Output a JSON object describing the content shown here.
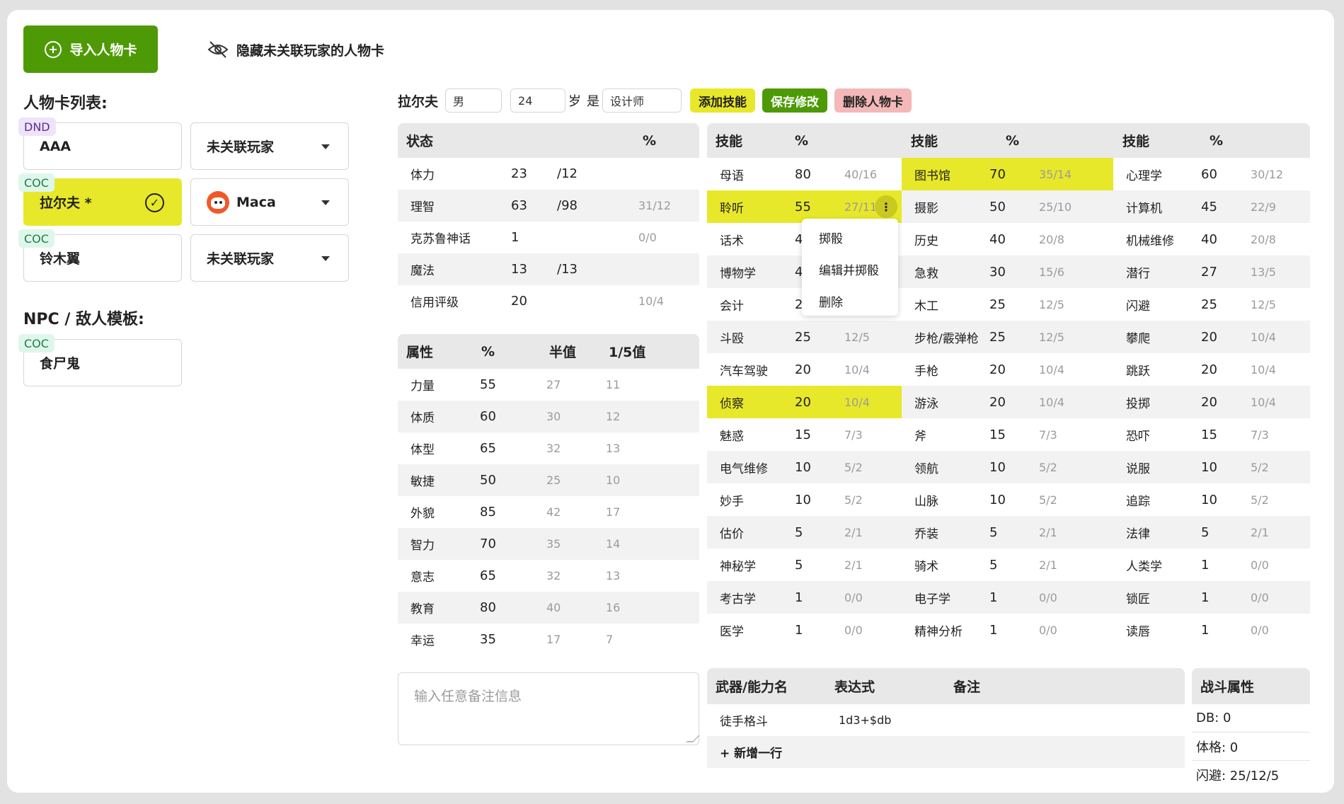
{
  "toolbar": {
    "import_label": "导入人物卡",
    "hide_label": "隐藏未关联玩家的人物卡"
  },
  "character_list": {
    "title": "人物卡列表:",
    "items": [
      {
        "tag": "DND",
        "name": "AAA",
        "player": "未关联玩家"
      },
      {
        "tag": "COC",
        "name": "拉尔夫 *",
        "player": "Maca"
      },
      {
        "tag": "COC",
        "name": "铃木翼",
        "player": "未关联玩家"
      }
    ]
  },
  "npc_list": {
    "title": "NPC / 敌人模板:",
    "items": [
      {
        "tag": "COC",
        "name": "食尸鬼"
      }
    ]
  },
  "header": {
    "name": "拉尔夫",
    "gender": "男",
    "age": "24",
    "age_suffix": "岁",
    "is_label": "是",
    "occupation": "设计师",
    "add_skill": "添加技能",
    "save": "保存修改",
    "delete": "删除人物卡"
  },
  "status_table": {
    "headers": [
      "状态",
      "%"
    ],
    "rows": [
      {
        "name": "体力",
        "value": "23",
        "max": "/12",
        "extra": ""
      },
      {
        "name": "理智",
        "value": "63",
        "max": "/98",
        "extra": "31/12"
      },
      {
        "name": "克苏鲁神话",
        "value": "1",
        "max": "",
        "extra": "0/0"
      },
      {
        "name": "魔法",
        "value": "13",
        "max": "/13",
        "extra": ""
      },
      {
        "name": "信用评级",
        "value": "20",
        "max": "",
        "extra": "10/4"
      }
    ]
  },
  "attr_table": {
    "headers": [
      "属性",
      "%",
      "半值",
      "1/5值"
    ],
    "rows": [
      {
        "name": "力量",
        "value": "55",
        "half": "27",
        "fifth": "11"
      },
      {
        "name": "体质",
        "value": "60",
        "half": "30",
        "fifth": "12"
      },
      {
        "name": "体型",
        "value": "65",
        "half": "32",
        "fifth": "13"
      },
      {
        "name": "敏捷",
        "value": "50",
        "half": "25",
        "fifth": "10"
      },
      {
        "name": "外貌",
        "value": "85",
        "half": "42",
        "fifth": "17"
      },
      {
        "name": "智力",
        "value": "70",
        "half": "35",
        "fifth": "14"
      },
      {
        "name": "意志",
        "value": "65",
        "half": "32",
        "fifth": "13"
      },
      {
        "name": "教育",
        "value": "80",
        "half": "40",
        "fifth": "16"
      },
      {
        "name": "幸运",
        "value": "35",
        "half": "17",
        "fifth": "7"
      }
    ]
  },
  "skills": {
    "headers": [
      "技能",
      "%"
    ],
    "col1": [
      {
        "name": "母语",
        "value": "80",
        "sub": "40/16",
        "hl": false
      },
      {
        "name": "聆听",
        "value": "55",
        "sub": "27/11",
        "hl": true
      },
      {
        "name": "话术",
        "value": "4",
        "sub": "",
        "hl": false
      },
      {
        "name": "博物学",
        "value": "4",
        "sub": "",
        "hl": false
      },
      {
        "name": "会计",
        "value": "2",
        "sub": "",
        "hl": false
      },
      {
        "name": "斗殴",
        "value": "25",
        "sub": "12/5",
        "hl": false
      },
      {
        "name": "汽车驾驶",
        "value": "20",
        "sub": "10/4",
        "hl": false
      },
      {
        "name": "侦察",
        "value": "20",
        "sub": "10/4",
        "hl": true
      },
      {
        "name": "魅惑",
        "value": "15",
        "sub": "7/3",
        "hl": false
      },
      {
        "name": "电气维修",
        "value": "10",
        "sub": "5/2",
        "hl": false
      },
      {
        "name": "妙手",
        "value": "10",
        "sub": "5/2",
        "hl": false
      },
      {
        "name": "估价",
        "value": "5",
        "sub": "2/1",
        "hl": false
      },
      {
        "name": "神秘学",
        "value": "5",
        "sub": "2/1",
        "hl": false
      },
      {
        "name": "考古学",
        "value": "1",
        "sub": "0/0",
        "hl": false
      },
      {
        "name": "医学",
        "value": "1",
        "sub": "0/0",
        "hl": false
      }
    ],
    "col2": [
      {
        "name": "图书馆",
        "value": "70",
        "sub": "35/14",
        "hl": true
      },
      {
        "name": "摄影",
        "value": "50",
        "sub": "25/10",
        "hl": false
      },
      {
        "name": "历史",
        "value": "40",
        "sub": "20/8",
        "hl": false
      },
      {
        "name": "急救",
        "value": "30",
        "sub": "15/6",
        "hl": false
      },
      {
        "name": "木工",
        "value": "25",
        "sub": "12/5",
        "hl": false
      },
      {
        "name": "步枪/霰弹枪",
        "value": "25",
        "sub": "12/5",
        "hl": false
      },
      {
        "name": "手枪",
        "value": "20",
        "sub": "10/4",
        "hl": false
      },
      {
        "name": "游泳",
        "value": "20",
        "sub": "10/4",
        "hl": false
      },
      {
        "name": "斧",
        "value": "15",
        "sub": "7/3",
        "hl": false
      },
      {
        "name": "领航",
        "value": "10",
        "sub": "5/2",
        "hl": false
      },
      {
        "name": "山脉",
        "value": "10",
        "sub": "5/2",
        "hl": false
      },
      {
        "name": "乔装",
        "value": "5",
        "sub": "2/1",
        "hl": false
      },
      {
        "name": "骑术",
        "value": "5",
        "sub": "2/1",
        "hl": false
      },
      {
        "name": "电子学",
        "value": "1",
        "sub": "0/0",
        "hl": false
      },
      {
        "name": "精神分析",
        "value": "1",
        "sub": "0/0",
        "hl": false
      }
    ],
    "col3": [
      {
        "name": "心理学",
        "value": "60",
        "sub": "30/12",
        "hl": false
      },
      {
        "name": "计算机",
        "value": "45",
        "sub": "22/9",
        "hl": false
      },
      {
        "name": "机械维修",
        "value": "40",
        "sub": "20/8",
        "hl": false
      },
      {
        "name": "潜行",
        "value": "27",
        "sub": "13/5",
        "hl": false
      },
      {
        "name": "闪避",
        "value": "25",
        "sub": "12/5",
        "hl": false
      },
      {
        "name": "攀爬",
        "value": "20",
        "sub": "10/4",
        "hl": false
      },
      {
        "name": "跳跃",
        "value": "20",
        "sub": "10/4",
        "hl": false
      },
      {
        "name": "投掷",
        "value": "20",
        "sub": "10/4",
        "hl": false
      },
      {
        "name": "恐吓",
        "value": "15",
        "sub": "7/3",
        "hl": false
      },
      {
        "name": "说服",
        "value": "10",
        "sub": "5/2",
        "hl": false
      },
      {
        "name": "追踪",
        "value": "10",
        "sub": "5/2",
        "hl": false
      },
      {
        "name": "法律",
        "value": "5",
        "sub": "2/1",
        "hl": false
      },
      {
        "name": "人类学",
        "value": "1",
        "sub": "0/0",
        "hl": false
      },
      {
        "name": "锁匠",
        "value": "1",
        "sub": "0/0",
        "hl": false
      },
      {
        "name": "读唇",
        "value": "1",
        "sub": "0/0",
        "hl": false
      }
    ]
  },
  "context_menu": {
    "items": [
      "掷骰",
      "编辑并掷骰",
      "删除"
    ]
  },
  "notes": {
    "placeholder": "输入任意备注信息"
  },
  "weapons": {
    "headers": [
      "武器/能力名",
      "表达式",
      "备注"
    ],
    "rows": [
      {
        "name": "徒手格斗",
        "expr": "1d3+$db",
        "note": ""
      }
    ],
    "add_row": "+ 新增一行"
  },
  "combat": {
    "title": "战斗属性",
    "items": [
      "DB: 0",
      "体格: 0",
      "闪避: 25/12/5"
    ]
  },
  "colors": {
    "accent_green": "#4e9a06",
    "highlight_yellow": "#e8e82a",
    "delete_pink": "#f4b8b8"
  }
}
